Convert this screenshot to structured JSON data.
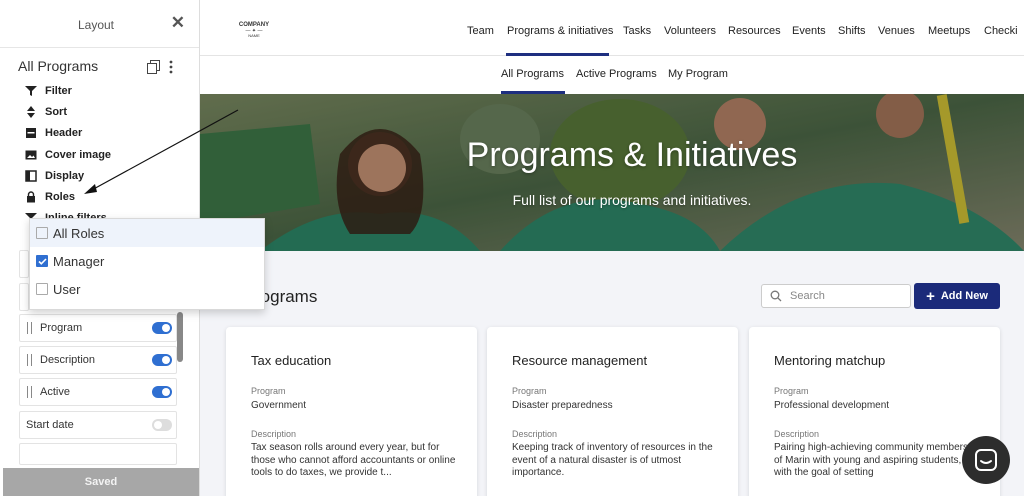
{
  "panel": {
    "title": "Layout",
    "view_name": "All Programs",
    "options": [
      {
        "label": "Filter",
        "icon": "filter-icon"
      },
      {
        "label": "Sort",
        "icon": "sort-icon"
      },
      {
        "label": "Header",
        "icon": "header-icon"
      },
      {
        "label": "Cover image",
        "icon": "image-icon"
      },
      {
        "label": "Display",
        "icon": "display-icon"
      },
      {
        "label": "Roles",
        "icon": "lock-icon"
      },
      {
        "label": "Inline filters",
        "icon": "filter-icon"
      }
    ],
    "roles": [
      {
        "label": "All Roles",
        "checked": false
      },
      {
        "label": "Manager",
        "checked": true
      },
      {
        "label": "User",
        "checked": false
      }
    ],
    "fields": [
      {
        "label": "Program",
        "on": true
      },
      {
        "label": "Description",
        "on": true
      },
      {
        "label": "Active",
        "on": true
      },
      {
        "label": "Start date",
        "on": false
      }
    ],
    "saved_label": "Saved"
  },
  "logo": {
    "line1": "COMPANY",
    "line2": "NAME"
  },
  "nav": [
    "Team",
    "Programs & initiatives",
    "Tasks",
    "Volunteers",
    "Resources",
    "Events",
    "Shifts",
    "Venues",
    "Meetups",
    "Checki"
  ],
  "subnav": [
    "All Programs",
    "Active Programs",
    "My Program"
  ],
  "hero": {
    "title": "Programs & Initiatives",
    "subtitle": "Full list of our programs and initiatives."
  },
  "section": {
    "title": "rograms",
    "search_placeholder": "Search",
    "add_label": "Add New"
  },
  "cards": [
    {
      "title": "Tax education",
      "program_label": "Program",
      "program": "Government",
      "desc_label": "Description",
      "description": "Tax season rolls around every year, but for those who cannot afford accountants or online tools to do taxes, we provide t..."
    },
    {
      "title": "Resource management",
      "program_label": "Program",
      "program": "Disaster preparedness",
      "desc_label": "Description",
      "description": "Keeping track of inventory of resources in the event of a natural disaster is of utmost importance."
    },
    {
      "title": "Mentoring matchup",
      "program_label": "Program",
      "program": "Professional development",
      "desc_label": "Description",
      "description": "Pairing high-achieving community members of Marin with young and aspiring students, with the goal of setting"
    }
  ],
  "colors": {
    "accent": "#1b2a7a",
    "toggle_on": "#2f6fd1"
  }
}
